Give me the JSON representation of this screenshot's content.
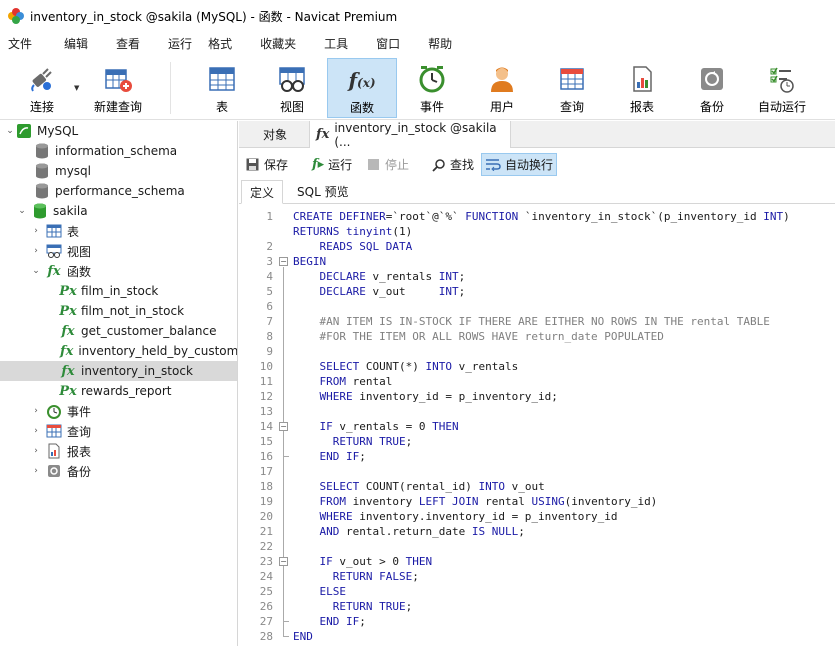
{
  "window": {
    "title": "inventory_in_stock @sakila (MySQL) - 函数 - Navicat Premium"
  },
  "menu": [
    "文件",
    "编辑",
    "查看",
    "运行",
    "格式",
    "收藏夹",
    "工具",
    "窗口",
    "帮助"
  ],
  "toolbar": {
    "connect": "连接",
    "new_query": "新建查询",
    "table": "表",
    "view": "视图",
    "function": "函数",
    "event": "事件",
    "user": "用户",
    "query": "查询",
    "report": "报表",
    "backup": "备份",
    "automation": "自动运行"
  },
  "tree": {
    "connection": "MySQL",
    "databases": [
      "information_schema",
      "mysql",
      "performance_schema",
      "sakila"
    ],
    "sakila_children": {
      "tables": "表",
      "views": "视图",
      "functions": "函数",
      "events": "事件",
      "queries": "查询",
      "reports": "报表",
      "backups": "备份"
    },
    "functions": [
      "film_in_stock",
      "film_not_in_stock",
      "get_customer_balance",
      "inventory_held_by_customer",
      "inventory_in_stock",
      "rewards_report"
    ],
    "selected_function": "inventory_in_stock"
  },
  "tabs": {
    "objects": "对象",
    "editor": "inventory_in_stock @sakila (..."
  },
  "editor_toolbar": {
    "save": "保存",
    "run": "运行",
    "stop": "停止",
    "find": "查找",
    "word_wrap": "自动换行"
  },
  "subtabs": {
    "definition": "定义",
    "sql_preview": "SQL 预览"
  },
  "code_lines": [
    {
      "n": "1",
      "t": "CREATE DEFINER=`root`@`%` FUNCTION `inventory_in_stock`(p_inventory_id INT)"
    },
    {
      "n": "",
      "t": "RETURNS tinyint(1)"
    },
    {
      "n": "2",
      "t": "    READS SQL DATA"
    },
    {
      "n": "3",
      "t": "BEGIN"
    },
    {
      "n": "4",
      "t": "    DECLARE v_rentals INT;"
    },
    {
      "n": "5",
      "t": "    DECLARE v_out     INT;"
    },
    {
      "n": "6",
      "t": ""
    },
    {
      "n": "7",
      "t": "    #AN ITEM IS IN-STOCK IF THERE ARE EITHER NO ROWS IN THE rental TABLE"
    },
    {
      "n": "8",
      "t": "    #FOR THE ITEM OR ALL ROWS HAVE return_date POPULATED"
    },
    {
      "n": "9",
      "t": ""
    },
    {
      "n": "10",
      "t": "    SELECT COUNT(*) INTO v_rentals"
    },
    {
      "n": "11",
      "t": "    FROM rental"
    },
    {
      "n": "12",
      "t": "    WHERE inventory_id = p_inventory_id;"
    },
    {
      "n": "13",
      "t": ""
    },
    {
      "n": "14",
      "t": "    IF v_rentals = 0 THEN"
    },
    {
      "n": "15",
      "t": "      RETURN TRUE;"
    },
    {
      "n": "16",
      "t": "    END IF;"
    },
    {
      "n": "17",
      "t": ""
    },
    {
      "n": "18",
      "t": "    SELECT COUNT(rental_id) INTO v_out"
    },
    {
      "n": "19",
      "t": "    FROM inventory LEFT JOIN rental USING(inventory_id)"
    },
    {
      "n": "20",
      "t": "    WHERE inventory.inventory_id = p_inventory_id"
    },
    {
      "n": "21",
      "t": "    AND rental.return_date IS NULL;"
    },
    {
      "n": "22",
      "t": ""
    },
    {
      "n": "23",
      "t": "    IF v_out > 0 THEN"
    },
    {
      "n": "24",
      "t": "      RETURN FALSE;"
    },
    {
      "n": "25",
      "t": "    ELSE"
    },
    {
      "n": "26",
      "t": "      RETURN TRUE;"
    },
    {
      "n": "27",
      "t": "    END IF;"
    },
    {
      "n": "28",
      "t": "END"
    }
  ],
  "colors": {
    "keyword": "#1a1aa6",
    "comment": "#808080",
    "active_toolbar_bg": "#cce4f7",
    "selected_row_bg": "#d9d9d9",
    "function_icon": "#2e8b3a",
    "database_icon": "#2e9b2e"
  }
}
